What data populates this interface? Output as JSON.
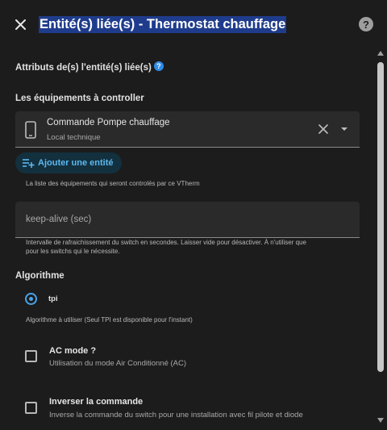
{
  "dialog": {
    "title": "Entité(s) liée(s) - Thermostat chauffage",
    "help_symbol": "?"
  },
  "linked_entities": {
    "label": "Attributs de(s) l'entité(s) liée(s)",
    "info_symbol": "?"
  },
  "equipments": {
    "label": "Les équipements à controller",
    "entity_name": "Commande Pompe chauffage",
    "entity_area": "Local technique",
    "add_button_label": "Ajouter une entité",
    "helper": "La liste des équipements qui seront controlés par ce VTherm"
  },
  "keep_alive": {
    "placeholder": "keep-alive (sec)",
    "value": "",
    "helper_line1": "Intervalle de rafraichissement du switch en secondes. Laisser vide pour désactiver. À n'utiliser que",
    "helper_line2": "pour les switchs qui le nécessite."
  },
  "algorithm": {
    "label": "Algorithme",
    "selected": "tpi",
    "helper": "Algorithme à utiliser (Seul TPI est disponible pour l'instant)"
  },
  "ac_mode": {
    "title": "AC mode ?",
    "description": "Utilisation du mode Air Conditionné (AC)",
    "checked": false
  },
  "invert_command": {
    "title": "Inverser la commande",
    "description": "Inverse la commande du switch pour une installation avec fil pilote et diode",
    "checked": false
  },
  "icons": {
    "close": "close-icon",
    "help": "help-icon",
    "info": "info-icon",
    "device": "phone-icon",
    "clear": "clear-icon",
    "dropdown": "chevron-down-icon",
    "add": "playlist-plus-icon"
  },
  "colors": {
    "background": "#1c1c1c",
    "field": "#2a2a2a",
    "accent": "#4aa3e8",
    "title_highlight": "#1f3c8c",
    "chip_background": "#13303f"
  }
}
